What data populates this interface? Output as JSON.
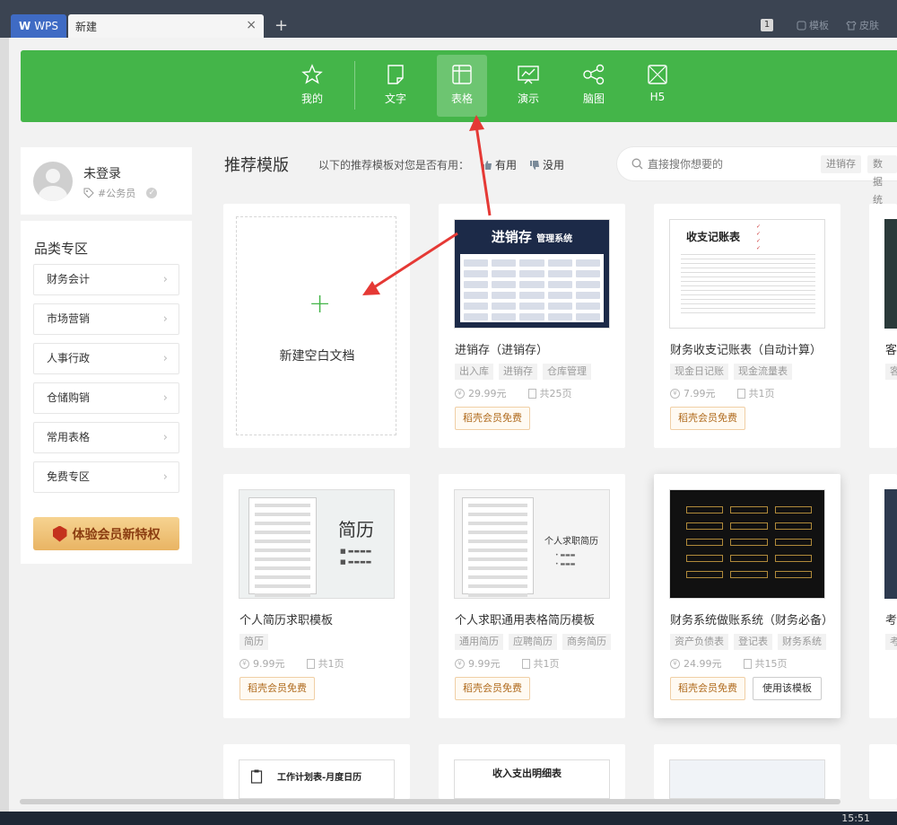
{
  "tabs": {
    "app": "WPS",
    "app_logo": "W",
    "current": "新建",
    "close": "×",
    "add": "+"
  },
  "titlebar": {
    "badge": "1",
    "template": "模板",
    "skin": "皮肤"
  },
  "nav": {
    "items": [
      {
        "label": "我的",
        "icon": "star-icon"
      },
      {
        "label": "文字",
        "icon": "doc-icon"
      },
      {
        "label": "表格",
        "icon": "table-icon"
      },
      {
        "label": "演示",
        "icon": "presentation-icon"
      },
      {
        "label": "脑图",
        "icon": "mindmap-icon"
      },
      {
        "label": "H5",
        "icon": "h5-icon"
      }
    ],
    "active": "表格"
  },
  "user": {
    "name": "未登录",
    "tag": "#公务员"
  },
  "categories": {
    "title": "品类专区",
    "items": [
      "财务会计",
      "市场营销",
      "人事行政",
      "仓储购销",
      "常用表格",
      "免费专区"
    ],
    "vip_button": "体验会员新特权"
  },
  "recommend": {
    "title": "推荐模版",
    "question": "以下的推荐模板对您是否有用：",
    "useful": "有用",
    "useless": "没用"
  },
  "search": {
    "placeholder": "直接搜你想要的",
    "tags": [
      "进销存",
      "数据统"
    ]
  },
  "blank": {
    "label": "新建空白文档",
    "plus": "+"
  },
  "cards": [
    {
      "title": "进销存（进销存）",
      "tags": [
        "出入库",
        "进销存",
        "仓库管理"
      ],
      "price": "29.99元",
      "pages": "共25页",
      "badge": "稻壳会员免费",
      "thumb_title": "进销存",
      "thumb_sub": "管理系统"
    },
    {
      "title": "财务收支记账表（自动计算）",
      "tags": [
        "现金日记账",
        "现金流量表"
      ],
      "price": "7.99元",
      "pages": "共1页",
      "badge": "稻壳会员免费",
      "thumb_title": "收支记账表"
    },
    {
      "title": "个人简历求职模板",
      "tags": [
        "简历"
      ],
      "price": "9.99元",
      "pages": "共1页",
      "badge": "稻壳会员免费",
      "thumb_title": "简历"
    },
    {
      "title": "个人求职通用表格简历模板",
      "tags": [
        "通用简历",
        "应聘简历",
        "商务简历"
      ],
      "price": "9.99元",
      "pages": "共1页",
      "badge": "稻壳会员免费",
      "thumb_title": "个人求职简历"
    },
    {
      "title": "财务系统做账系统（财务必备）",
      "tags": [
        "资产负债表",
        "登记表",
        "财务系统"
      ],
      "price": "24.99元",
      "pages": "共15页",
      "badge": "稻壳会员免费",
      "use_button": "使用该模板"
    },
    {
      "thumb_title": "工作计划表-月度日历"
    },
    {
      "thumb_title": "收入支出明细表"
    }
  ],
  "partial_titles": [
    "客",
    "考"
  ],
  "partial_tags": [
    "客",
    "考"
  ],
  "taskbar": {
    "clock": "15:51"
  },
  "colors": {
    "brand_green": "#44b549",
    "annotation_red": "#e53935"
  }
}
